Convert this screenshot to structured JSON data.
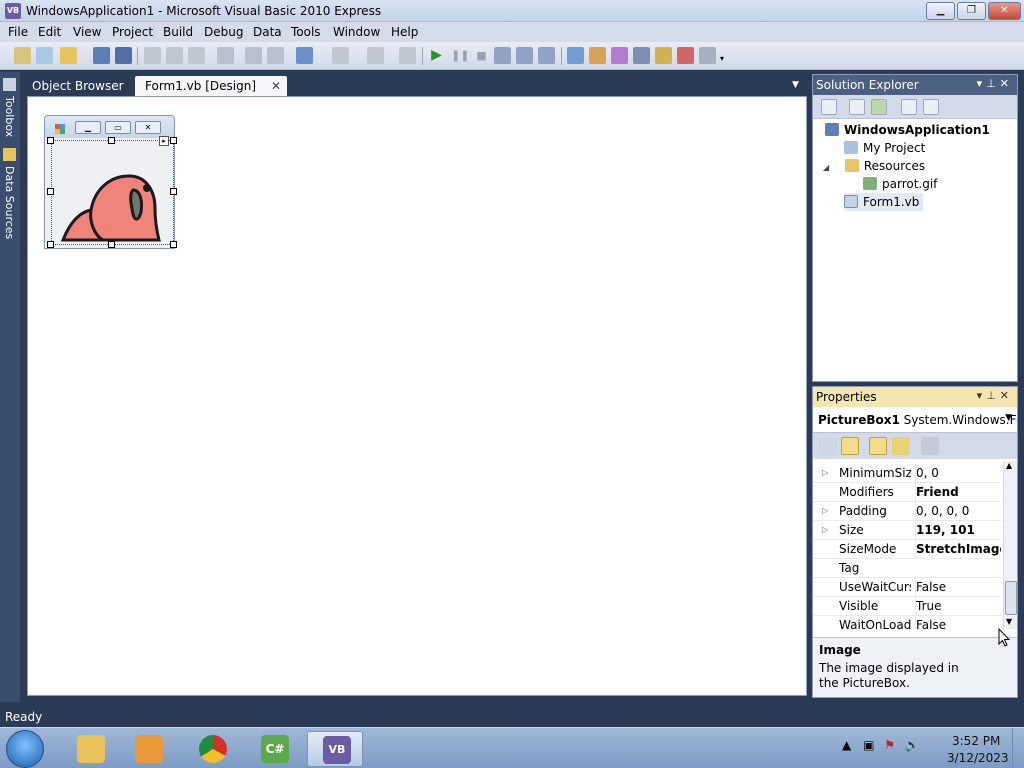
{
  "window": {
    "title": "WindowsApplication1 - Microsoft Visual Basic 2010 Express",
    "app_icon": "vb-express-icon"
  },
  "menu": [
    "File",
    "Edit",
    "View",
    "Project",
    "Build",
    "Debug",
    "Data",
    "Tools",
    "Window",
    "Help"
  ],
  "left_strip": {
    "toolbox": "Toolbox",
    "data_sources": "Data Sources"
  },
  "doc_tabs": {
    "object_browser": "Object Browser",
    "form1_design": "Form1.vb [Design]"
  },
  "solution_explorer": {
    "title": "Solution Explorer",
    "project": "WindowsApplication1",
    "my_project": "My Project",
    "resources": "Resources",
    "resource_file": "parrot.gif",
    "form_file": "Form1.vb"
  },
  "properties": {
    "title": "Properties",
    "object_name": "PictureBox1",
    "object_type": "System.Windows.For",
    "rows": [
      {
        "name": "MinimumSize",
        "value": "0, 0",
        "expandable": true,
        "bold": false
      },
      {
        "name": "Modifiers",
        "value": "Friend",
        "expandable": false,
        "bold": true
      },
      {
        "name": "Padding",
        "value": "0, 0, 0, 0",
        "expandable": true,
        "bold": false
      },
      {
        "name": "Size",
        "value": "119, 101",
        "expandable": true,
        "bold": true
      },
      {
        "name": "SizeMode",
        "value": "StretchImage",
        "expandable": false,
        "bold": true
      },
      {
        "name": "Tag",
        "value": "",
        "expandable": false,
        "bold": false
      },
      {
        "name": "UseWaitCursor",
        "value": "False",
        "expandable": false,
        "bold": false
      },
      {
        "name": "Visible",
        "value": "True",
        "expandable": false,
        "bold": false
      },
      {
        "name": "WaitOnLoad",
        "value": "False",
        "expandable": false,
        "bold": false
      }
    ],
    "description_title": "Image",
    "description_text": "The image displayed in the PictureBox."
  },
  "status": "Ready",
  "taskbar": {
    "apps": [
      "explorer-icon",
      "media-player-icon",
      "chrome-icon",
      "csharp-express-icon",
      "vb-express-icon"
    ],
    "time": "3:52 PM",
    "date": "3/12/2023"
  },
  "colors": {
    "accent": "#2b3a55",
    "properties_header": "#f3e6b0",
    "parrot": "#f2837a"
  }
}
